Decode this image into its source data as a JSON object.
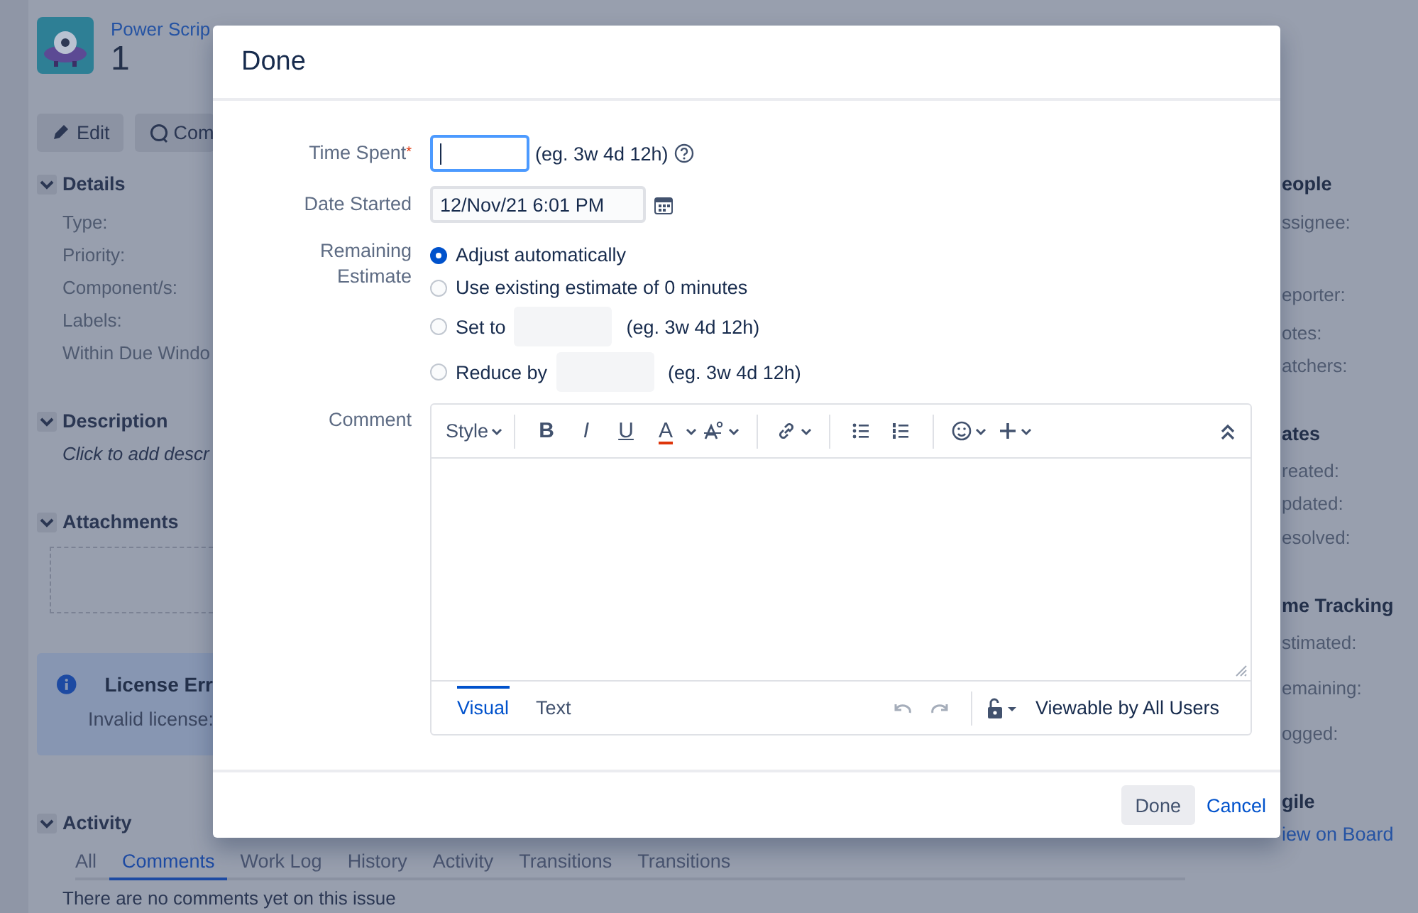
{
  "page": {
    "breadcrumb": "Power Scrip",
    "issue_title": "1",
    "actions": [
      "Edit",
      "Com"
    ],
    "details": {
      "heading": "Details",
      "expanded": true,
      "fields": [
        "Type:",
        "Priority:",
        "Component/s:",
        "Labels:",
        "Within Due Windo"
      ]
    },
    "description": {
      "heading": "Description",
      "expanded": true,
      "prompt": "Click to add descr"
    },
    "attachments": {
      "heading": "Attachments",
      "expanded": true
    },
    "license_notice": {
      "title": "License Err",
      "text": "Invalid license:"
    },
    "activity": {
      "heading": "Activity",
      "expanded": true,
      "tabs": [
        {
          "label": "All",
          "selected": false
        },
        {
          "label": "Comments",
          "selected": true
        },
        {
          "label": "Work Log",
          "selected": false
        },
        {
          "label": "History",
          "selected": false
        },
        {
          "label": "Activity",
          "selected": false
        },
        {
          "label": "Transitions",
          "selected": false
        },
        {
          "label": "Transitions",
          "selected": false
        }
      ],
      "empty_text": "There are no comments yet on this issue"
    },
    "sidebar": {
      "sections": [
        {
          "heading": "eople",
          "fields": [
            "ssignee:",
            "eporter:",
            "otes:",
            "atchers:"
          ]
        },
        {
          "heading": "ates",
          "fields": [
            "reated:",
            "pdated:",
            "esolved:"
          ]
        },
        {
          "heading": "me Tracking",
          "fields": [
            "stimated:",
            "emaining:",
            "ogged:"
          ]
        },
        {
          "heading": "gile"
        }
      ],
      "link": "iew on Board"
    }
  },
  "dialog": {
    "title": "Done",
    "time_spent": {
      "label": "Time Spent",
      "required_marker": "*",
      "focused": true,
      "hint": "(eg. 3w 4d 12h)"
    },
    "date_started": {
      "label": "Date Started",
      "value": "12/Nov/21 6:01 PM"
    },
    "remaining_estimate": {
      "label": "Remaining Estimate",
      "options": [
        {
          "label": "Adjust automatically",
          "selected": true
        },
        {
          "label": "Use existing estimate of 0 minutes",
          "selected": false
        },
        {
          "label": "Set to",
          "selected": false,
          "hint": "(eg. 3w 4d 12h)"
        },
        {
          "label": "Reduce by",
          "selected": false,
          "hint": "(eg. 3w 4d 12h)"
        }
      ]
    },
    "comment": {
      "label": "Comment",
      "style_menu": "Style",
      "format_buttons": [
        "B",
        "I",
        "U",
        "A"
      ],
      "modes": [
        {
          "label": "Visual",
          "selected": true
        },
        {
          "label": "Text",
          "selected": false
        }
      ],
      "visibility": "Viewable by All Users"
    },
    "buttons": [
      {
        "label": "Done",
        "kind": "button"
      },
      {
        "label": "Cancel",
        "kind": "link"
      }
    ]
  }
}
